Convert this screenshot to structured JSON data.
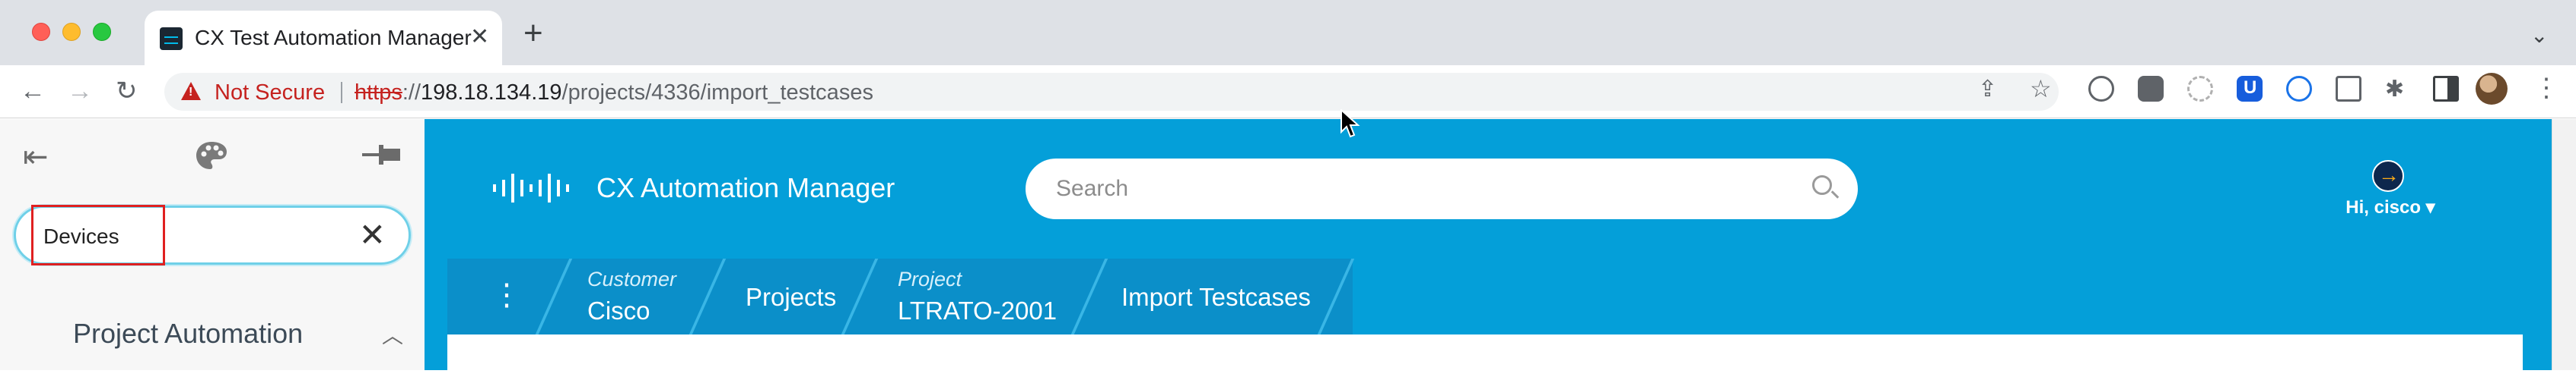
{
  "browser": {
    "tab_title": "CX Test Automation Manager",
    "tab_close_glyph": "✕",
    "new_tab_glyph": "+",
    "tab_overflow_glyph": "⌄",
    "security_label": "Not Secure",
    "url_scheme": "https",
    "url_sep": "://",
    "url_host": "198.18.134.19",
    "url_path": "/projects/4336/import_testcases",
    "nav": {
      "back_glyph": "←",
      "forward_glyph": "→",
      "reload_glyph": "↻"
    },
    "extension_icons": [
      "share-icon",
      "star-icon",
      "extension-icon",
      "extension-icon",
      "extension-icon",
      "bitwarden-icon",
      "extension-icon",
      "screenshot-icon",
      "puzzle-icon",
      "sidepanel-icon"
    ],
    "menu_glyph": "⋮"
  },
  "sidebar": {
    "collapse_glyph": "⇤",
    "palette_glyph": "🎨",
    "pin_glyph": "⊸",
    "search_value": "Devices",
    "clear_glyph": "✕",
    "section_title": "Project Automation",
    "section_chevron": "︿"
  },
  "app": {
    "title": "CX Automation Manager",
    "search_placeholder": "Search",
    "user_greeting": "Hi, cisco ▾",
    "breadcrumb": {
      "menu_glyph": "⋮",
      "items": [
        {
          "label": "Customer",
          "value": "Cisco"
        },
        {
          "label": "",
          "value": "Projects"
        },
        {
          "label": "Project",
          "value": "LTRATO-2001"
        },
        {
          "label": "",
          "value": "Import Testcases"
        }
      ]
    }
  },
  "colors": {
    "app_background": "#049fd9",
    "breadcrumb_background": "#0b8fc9",
    "not_secure": "#c5221f",
    "highlight_box": "#e02020"
  }
}
